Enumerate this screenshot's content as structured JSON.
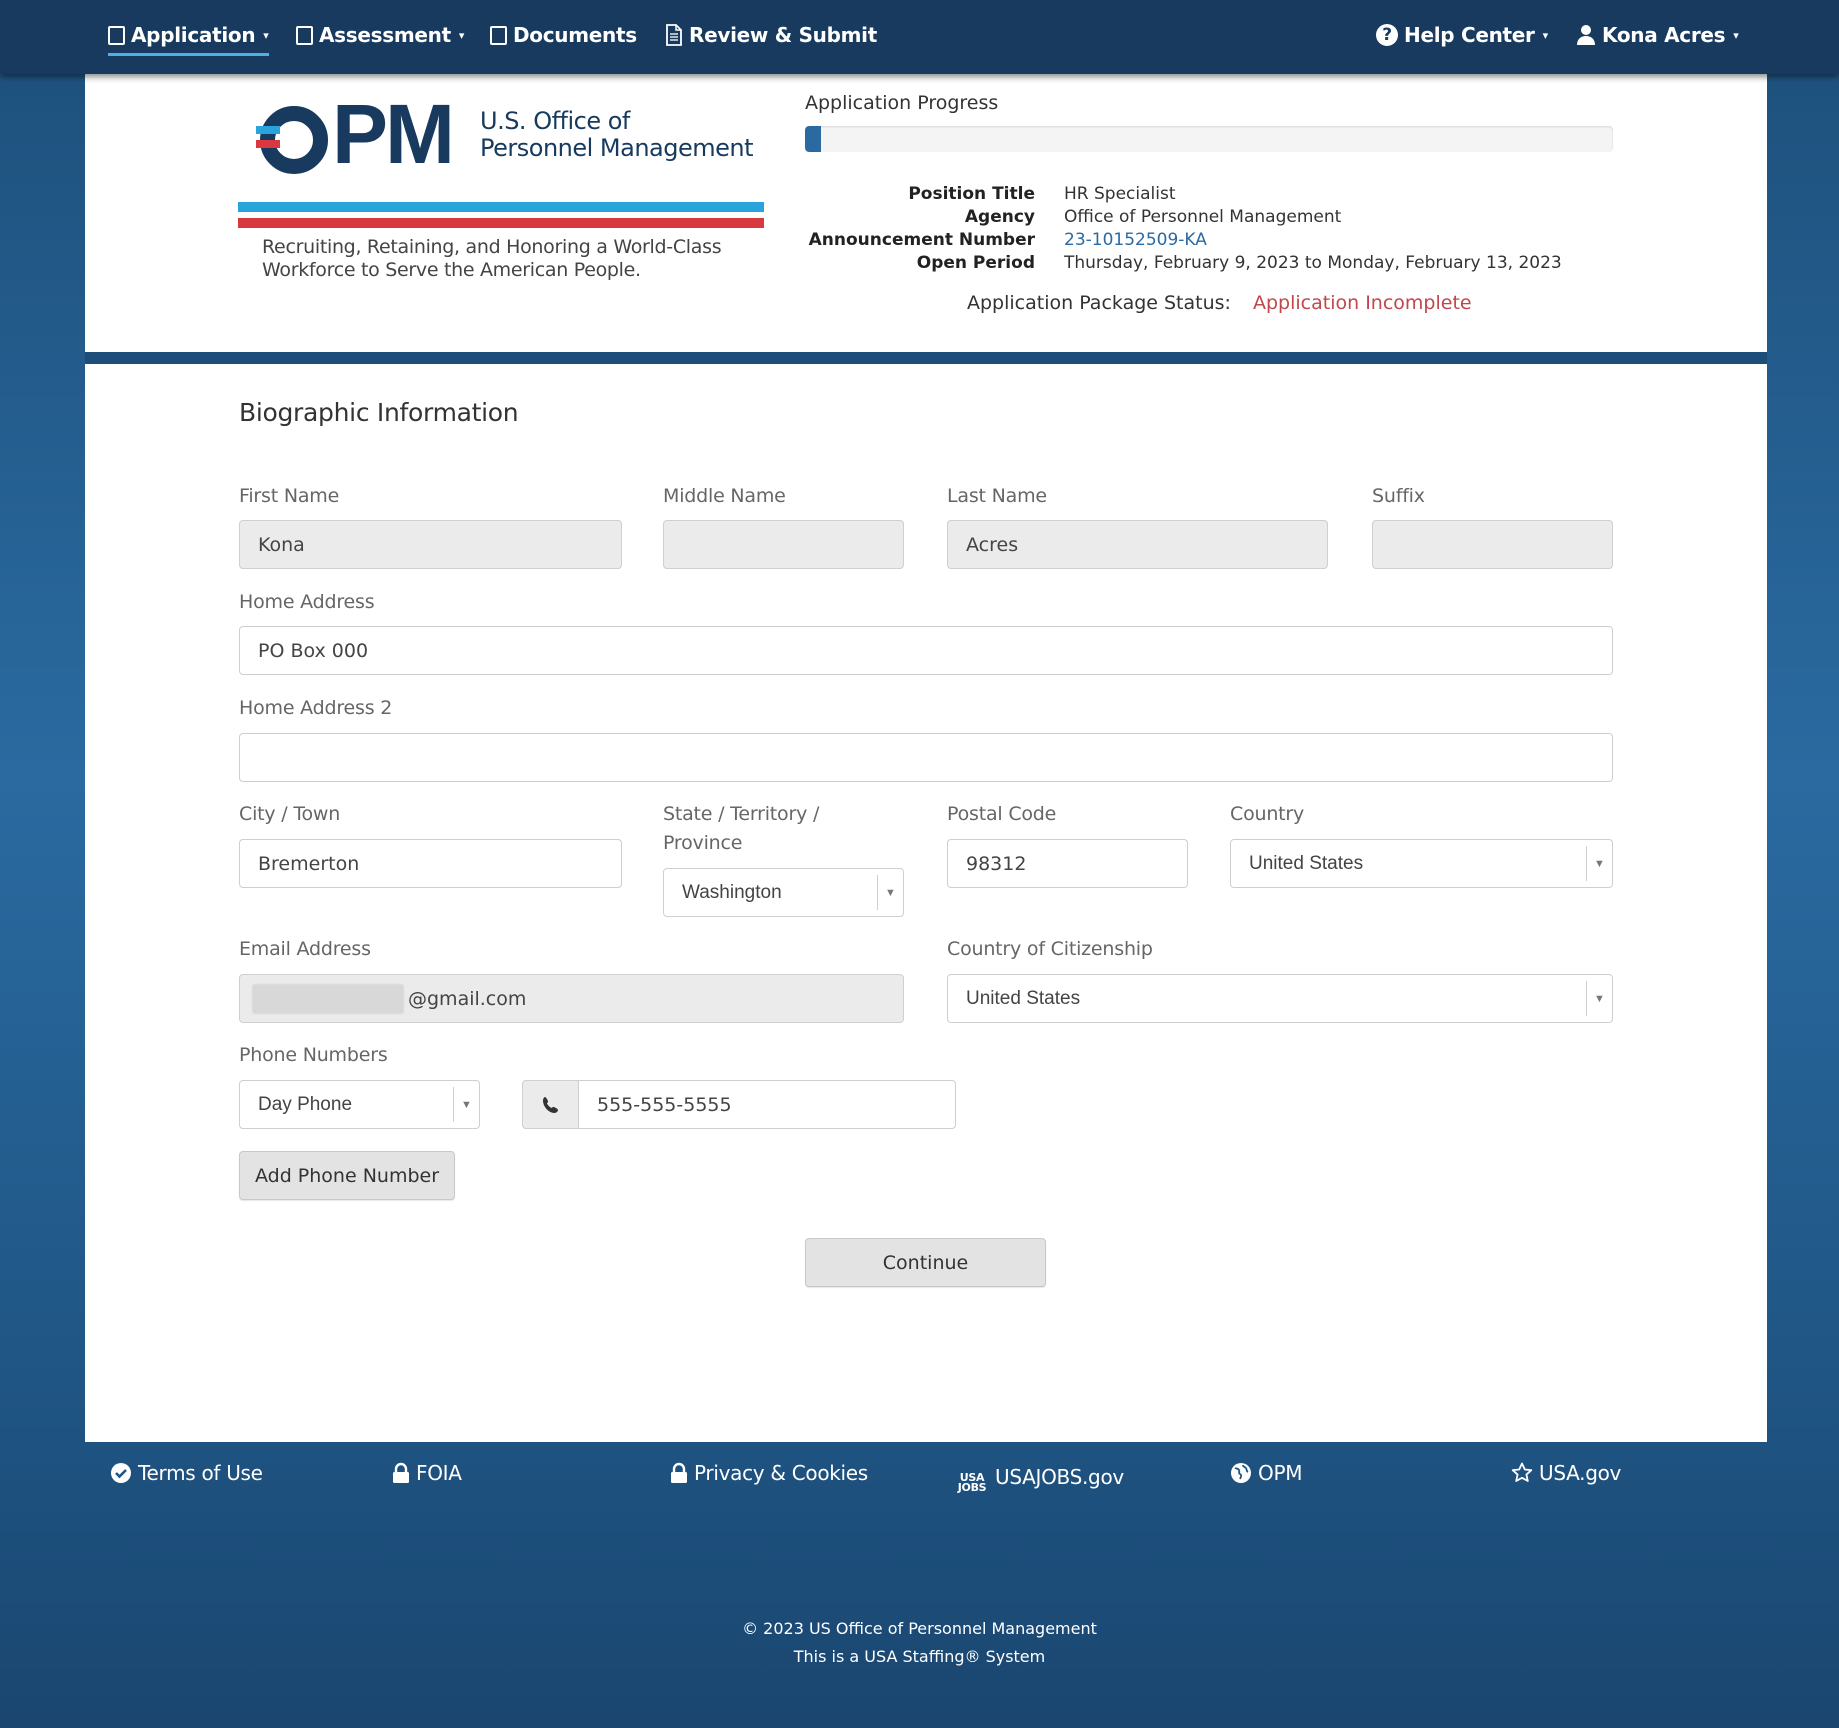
{
  "nav": {
    "items": [
      {
        "label": "Application",
        "caret": "▾",
        "icon": "checkbox-icon"
      },
      {
        "label": "Assessment",
        "caret": "▾",
        "icon": "checkbox-icon"
      },
      {
        "label": "Documents",
        "icon": "checkbox-icon"
      },
      {
        "label": "Review & Submit",
        "icon": "document-icon"
      }
    ],
    "help": {
      "label": "Help Center",
      "caret": "▾",
      "icon": "question-circle-icon"
    },
    "user": {
      "label": "Kona Acres",
      "caret": "▾",
      "icon": "user-icon"
    }
  },
  "header": {
    "logo": {
      "letters": "OPM",
      "name_line1": "U.S. Office of",
      "name_line2": "Personnel Management",
      "tagline_line1": "Recruiting, Retaining, and Honoring a World-Class",
      "tagline_line2": "Workforce to Serve the American People."
    },
    "progress": {
      "label": "Application Progress",
      "fraction": 0.02
    },
    "info": [
      {
        "key": "Position Title",
        "value": "HR Specialist"
      },
      {
        "key": "Agency",
        "value": "Office of Personnel Management"
      },
      {
        "key": "Announcement Number",
        "value": "23-10152509-KA"
      },
      {
        "key": "Open Period",
        "value": "Thursday, February 9, 2023 to Monday, February 13, 2023"
      }
    ],
    "package_status": {
      "label": "Application Package Status:",
      "value": "Application Incomplete"
    },
    "colors": {
      "navy": "#173a5e",
      "blue": "#29a3dc",
      "red": "#d7393e",
      "status": "#c0474b"
    }
  },
  "form": {
    "title": "Biographic Information",
    "first_name": {
      "label": "First Name",
      "value": "Kona"
    },
    "middle_name": {
      "label": "Middle Name",
      "value": ""
    },
    "last_name": {
      "label": "Last Name",
      "value": "Acres"
    },
    "suffix": {
      "label": "Suffix",
      "value": ""
    },
    "home_address": {
      "label": "Home Address",
      "value": "PO Box 000"
    },
    "home_address2": {
      "label": "Home Address 2",
      "value": ""
    },
    "city": {
      "label": "City / Town",
      "value": "Bremerton"
    },
    "state": {
      "label_line1": "State / Territory /",
      "label_line2": "Province",
      "value": "Washington"
    },
    "postal": {
      "label": "Postal Code",
      "value": "98312"
    },
    "country": {
      "label": "Country",
      "value": "United States"
    },
    "email": {
      "label": "Email Address",
      "value": "@gmail.com"
    },
    "citizenship": {
      "label": "Country of Citizenship",
      "value": "United States"
    },
    "phones": {
      "label": "Phone Numbers",
      "type": "Day Phone",
      "number": "555-555-5555"
    },
    "add_phone": "Add Phone Number",
    "continue": "Continue"
  },
  "footer": {
    "links": [
      {
        "label": "Terms of Use",
        "icon": "check-circle-icon"
      },
      {
        "label": "FOIA",
        "icon": "lock-icon"
      },
      {
        "label": "Privacy & Cookies",
        "icon": "lock-icon"
      },
      {
        "label": "USAJOBS.gov",
        "icon": "usajobs-icon",
        "mark_line1": "USA",
        "mark_line2": "JOBS"
      },
      {
        "label": "OPM",
        "icon": "globe-icon"
      },
      {
        "label": "USA.gov",
        "icon": "star-icon"
      }
    ],
    "copyright": "© 2023 US Office of Personnel Management",
    "system": "This is a USA Staffing® System"
  }
}
